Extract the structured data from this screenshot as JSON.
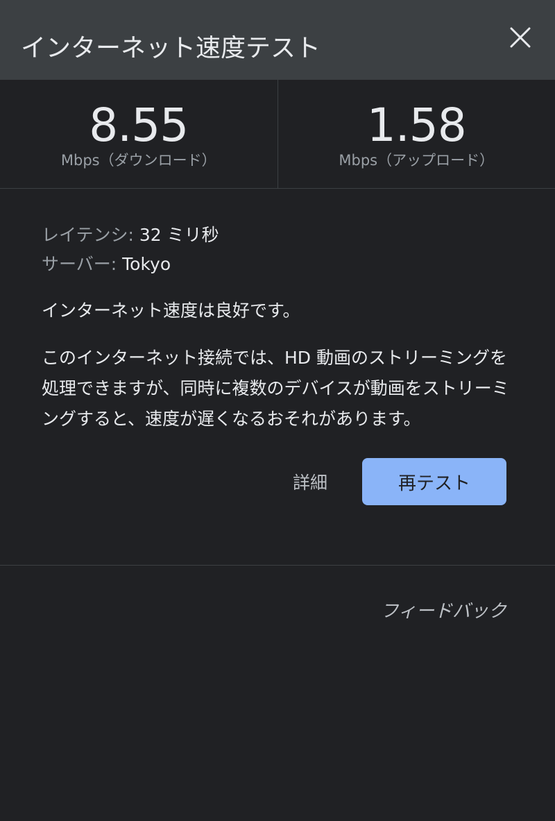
{
  "header": {
    "title": "インターネット速度テスト",
    "close_icon": "close-icon"
  },
  "download": {
    "value": "8.55",
    "unit": "Mbps（ダウンロード）"
  },
  "upload": {
    "value": "1.58",
    "unit": "Mbps（アップロード）"
  },
  "latency": {
    "label": "レイテンシ:",
    "value": "32 ミリ秒"
  },
  "server": {
    "label": "サーバー:",
    "value": "Tokyo"
  },
  "status": "インターネット速度は良好です。",
  "description": "このインターネット接続では、HD 動画のストリーミングを処理できますが、同時に複数のデバイスが動画をストリーミングすると、速度が遅くなるおそれがあります。",
  "actions": {
    "details_label": "詳細",
    "retest_label": "再テスト"
  },
  "feedback_label": "フィードバック",
  "colors": {
    "background": "#202124",
    "header_bg": "#3c4043",
    "accent": "#8ab4f8",
    "muted_text": "#9aa0a6"
  }
}
